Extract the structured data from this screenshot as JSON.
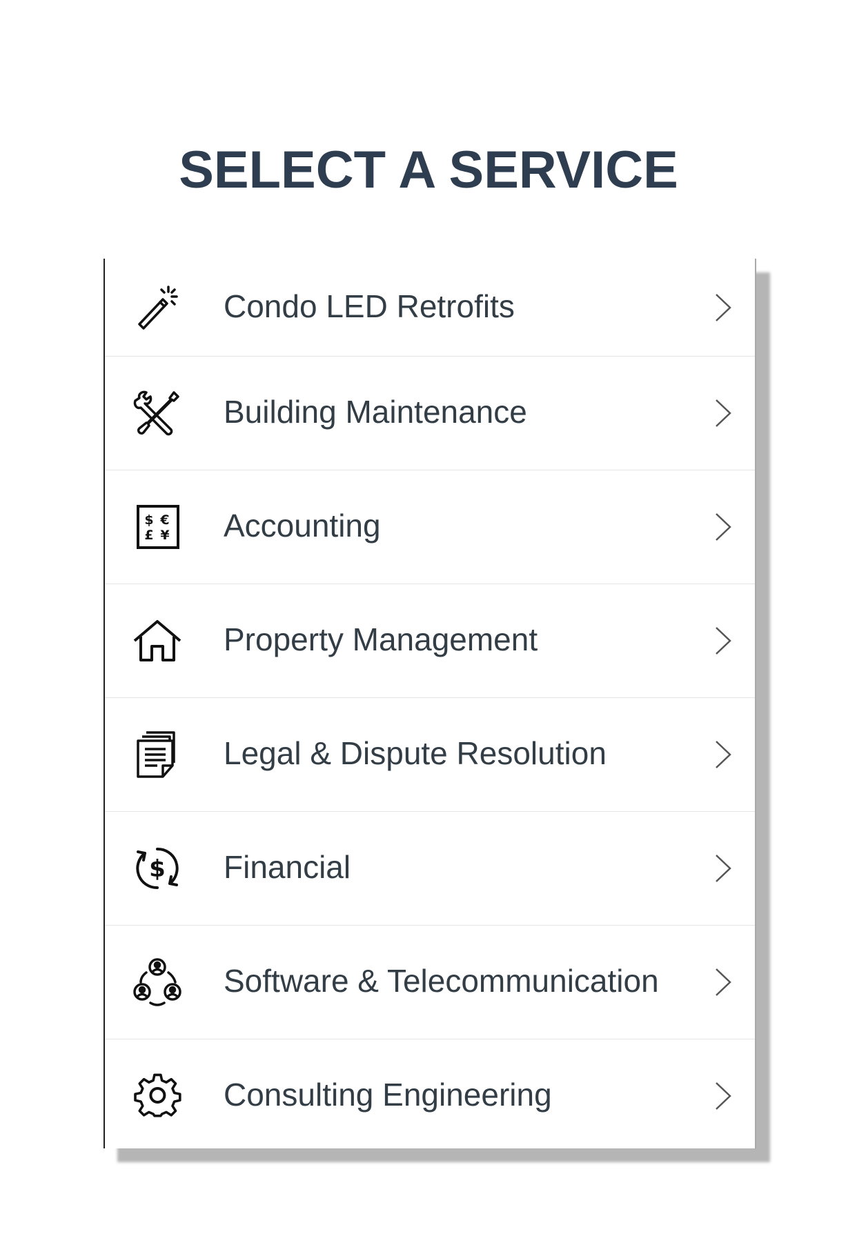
{
  "header": {
    "title": "SELECT A SERVICE"
  },
  "services": [
    {
      "label": "Condo LED Retrofits",
      "icon": "magic-wand-icon"
    },
    {
      "label": "Building Maintenance",
      "icon": "tools-icon"
    },
    {
      "label": "Accounting",
      "icon": "currency-icon"
    },
    {
      "label": "Property Management",
      "icon": "house-icon"
    },
    {
      "label": "Legal & Dispute Resolution",
      "icon": "documents-icon"
    },
    {
      "label": "Financial",
      "icon": "dollar-cycle-icon"
    },
    {
      "label": "Software & Telecommunication",
      "icon": "network-people-icon"
    },
    {
      "label": "Consulting Engineering",
      "icon": "gear-icon"
    }
  ],
  "colors": {
    "title": "#2e3e50",
    "label": "#333d46",
    "chevron": "#555555",
    "shadow": "#b5b5b5"
  }
}
